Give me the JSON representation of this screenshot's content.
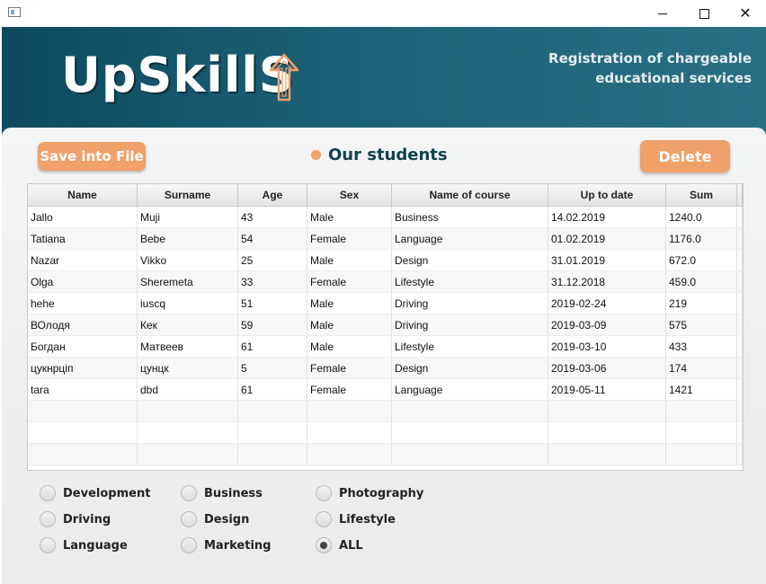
{
  "window": {
    "controls": {
      "minimize_icon": "minimize-icon",
      "maximize_icon": "maximize-icon",
      "close_glyph": "✕"
    }
  },
  "header": {
    "logo": "UpSkillS",
    "tagline_line1": "Registration of chargeable",
    "tagline_line2": "educational services",
    "colors": {
      "band": "#1c6177",
      "accent": "#f0a069"
    }
  },
  "toolbar": {
    "save_label": "Save into File",
    "section_title": "Our students",
    "delete_label": "Delete"
  },
  "table": {
    "columns": [
      "Name",
      "Surname",
      "Age",
      "Sex",
      "Name of course",
      "Up to date",
      "Sum"
    ],
    "rows": [
      [
        "Jallo",
        "Muji",
        "43",
        "Male",
        "Business",
        "14.02.2019",
        "1240.0"
      ],
      [
        "Tatiana",
        "Bebe",
        "54",
        "Female",
        "Language",
        "01.02.2019",
        "1176.0"
      ],
      [
        "Nazar",
        "Vikko",
        "25",
        "Male",
        "Design",
        "31.01.2019",
        "672.0"
      ],
      [
        "Olga",
        "Sheremeta",
        "33",
        "Female",
        "Lifestyle",
        "31.12.2018",
        "459.0"
      ],
      [
        "hehe",
        "iuscq",
        "51",
        "Male",
        "Driving",
        "2019-02-24",
        "219"
      ],
      [
        "ВОлодя",
        "Кек",
        "59",
        "Male",
        "Driving",
        "2019-03-09",
        "575"
      ],
      [
        "Богдан",
        "Матвеев",
        "61",
        "Male",
        "Lifestyle",
        "2019-03-10",
        "433"
      ],
      [
        "цукнрціп",
        "цунцк",
        "5",
        "Female",
        "Design",
        "2019-03-06",
        "174"
      ],
      [
        "tara",
        "dbd",
        "61",
        "Female",
        "Language",
        "2019-05-11",
        "1421"
      ]
    ]
  },
  "filters": {
    "options": [
      {
        "label": "Development",
        "selected": false
      },
      {
        "label": "Driving",
        "selected": false
      },
      {
        "label": "Language",
        "selected": false
      },
      {
        "label": "Business",
        "selected": false
      },
      {
        "label": "Design",
        "selected": false
      },
      {
        "label": "Marketing",
        "selected": false
      },
      {
        "label": "Photography",
        "selected": false
      },
      {
        "label": "Lifestyle",
        "selected": false
      },
      {
        "label": "ALL",
        "selected": true
      }
    ]
  }
}
